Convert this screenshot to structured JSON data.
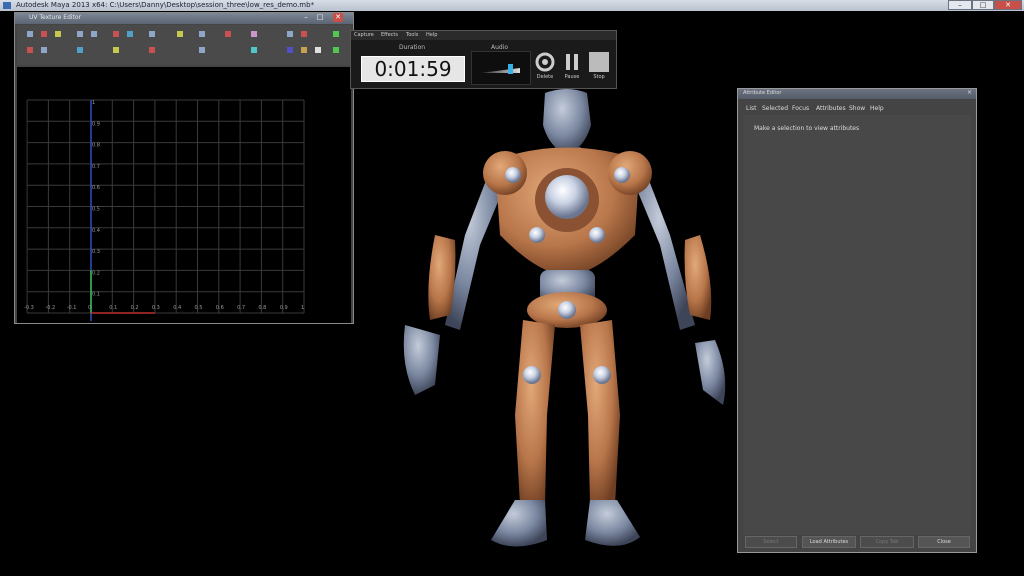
{
  "window": {
    "title": "Autodesk Maya 2013 x64: C:\\Users\\Danny\\Desktop\\session_three\\low_res_demo.mb*",
    "minimize": "–",
    "maximize": "□",
    "close": "✕"
  },
  "uv_editor": {
    "title": "UV Texture Editor",
    "y_ticks": [
      "1",
      "0.9",
      "0.8",
      "0.7",
      "0.6",
      "0.5",
      "0.4",
      "0.3",
      "0.2",
      "0.1"
    ],
    "x_ticks": [
      "-0.3",
      "-0.2",
      "-0.1",
      "0",
      "0.1",
      "0.2",
      "0.3",
      "0.4",
      "0.5",
      "0.6",
      "0.7",
      "0.8",
      "0.9",
      "1"
    ]
  },
  "capture": {
    "menu": [
      "Capture",
      "Effects",
      "Tools",
      "Help"
    ],
    "duration_label": "Duration",
    "duration_value": "0:01:59",
    "audio_label": "Audio",
    "audio_level": 0.75,
    "delete_label": "Delete",
    "pause_label": "Pause",
    "stop_label": "Stop"
  },
  "attribute_editor": {
    "title": "Attribute Editor",
    "menu": [
      "List",
      "Selected",
      "Focus",
      "Attributes",
      "Show",
      "Help"
    ],
    "message": "Make a selection to view attributes",
    "buttons": {
      "select": "Select",
      "load": "Load Attributes",
      "copy_tab": "Copy Tab",
      "close": "Close"
    }
  },
  "colors": {
    "accent": "#3a6ab0",
    "timer_bg": "#e6e6e6",
    "armor": "#b8764a",
    "skin": "#6f7d96"
  }
}
